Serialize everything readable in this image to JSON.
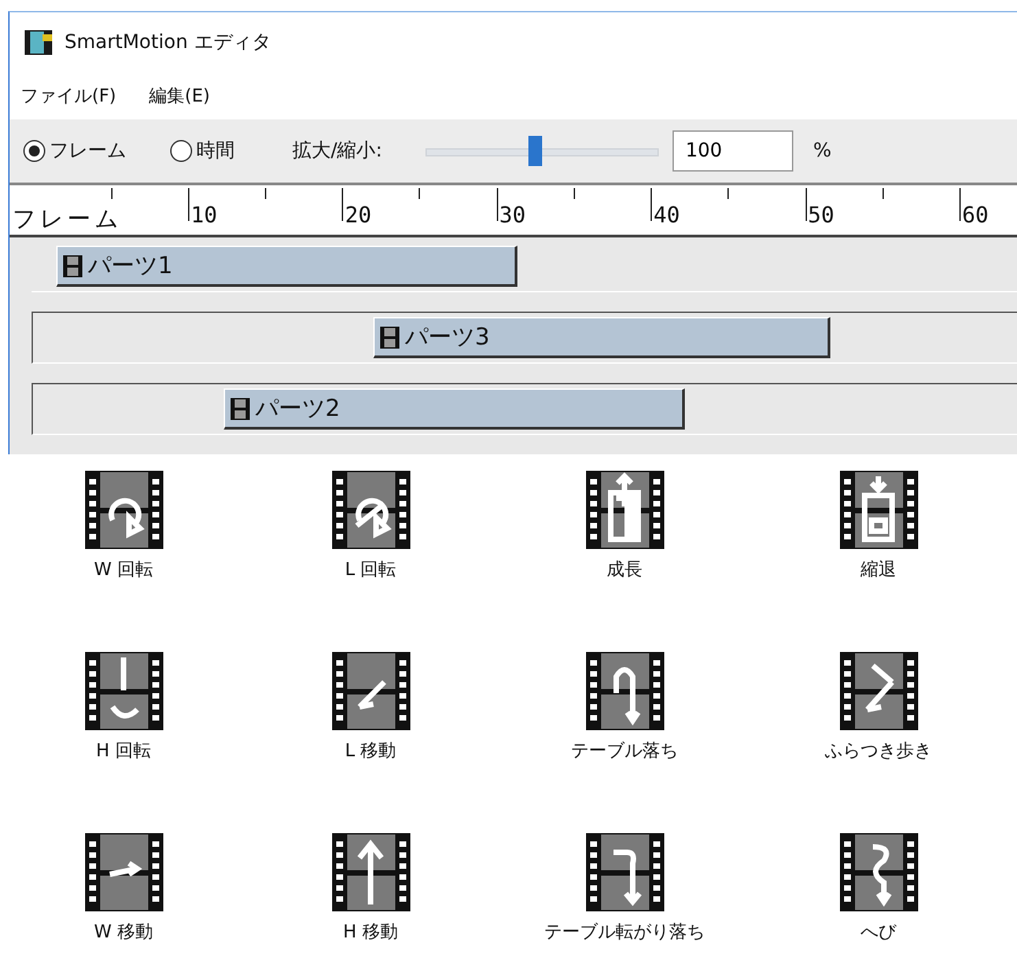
{
  "window": {
    "title": "SmartMotion エディタ"
  },
  "menu": [
    "ファイル(F)",
    "編集(E)"
  ],
  "toolbar": {
    "modes": [
      {
        "label": "フレーム",
        "selected": true
      },
      {
        "label": "時間",
        "selected": false
      }
    ],
    "zoom_label": "拡大/縮小:",
    "zoom": {
      "level": 0.47
    },
    "zoom_value": "100",
    "zoom_unit": "%"
  },
  "ruler": {
    "label": "フレーム",
    "marks": [
      "10",
      "20",
      "30",
      "40",
      "50",
      "60"
    ]
  },
  "tracks": [
    {
      "label": "パーツ1"
    },
    {
      "label": "パーツ3"
    },
    {
      "label": "パーツ2"
    }
  ],
  "motions": [
    {
      "label": "W 回転"
    },
    {
      "label": "L 回転"
    },
    {
      "label": "成長"
    },
    {
      "label": "縮退"
    },
    {
      "label": "H 回転"
    },
    {
      "label": "L 移動"
    },
    {
      "label": "テーブル落ち"
    },
    {
      "label": "ふらつき歩き"
    },
    {
      "label": "W 移動"
    },
    {
      "label": "H 移動"
    },
    {
      "label": "テーブル転がり落ち"
    },
    {
      "label": "へび"
    }
  ]
}
